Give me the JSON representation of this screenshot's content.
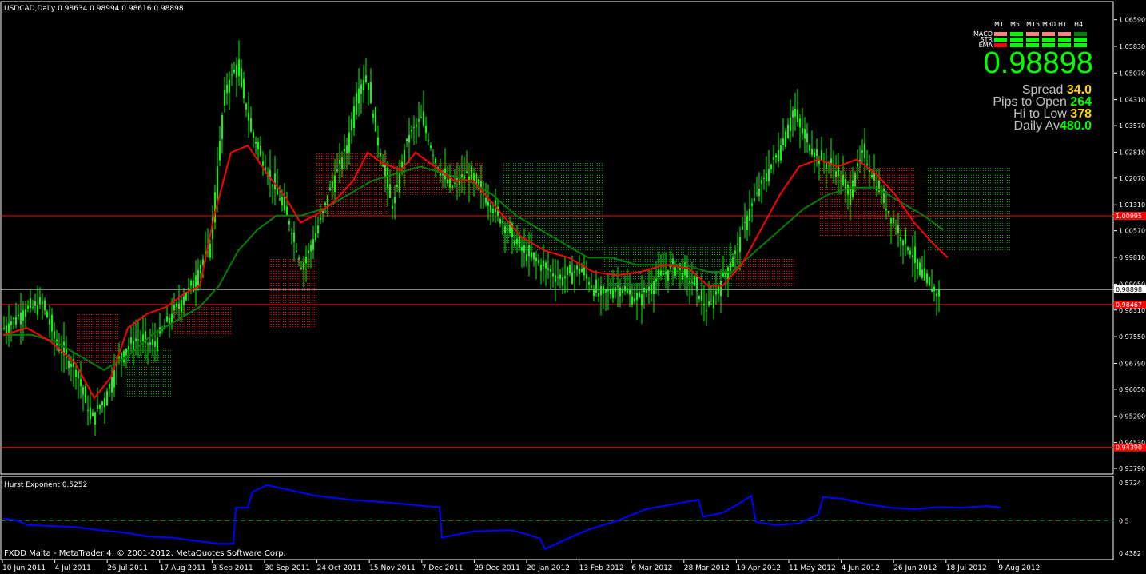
{
  "window": {
    "symbol_header": "USDCAD,Daily  0.98634 0.98994 0.98616 0.98898",
    "footer": "FXDD Malta - MetaTrader 4, © 2001-2012, MetaQuotes Software Corp."
  },
  "hud": {
    "timeframes": [
      "M1",
      "M5",
      "M15",
      "M30",
      "H1",
      "H4"
    ],
    "rows": [
      {
        "name": "MACD",
        "colors": [
          "#ff8080",
          "#00ff00",
          "#ff8080",
          "#ff8080",
          "#ff8080",
          "#008000"
        ]
      },
      {
        "name": "STR",
        "colors": [
          "#00ff00",
          "#00ff00",
          "#00ff00",
          "#00ff00",
          "#00ff00",
          "#00ff00"
        ]
      },
      {
        "name": "EMA",
        "colors": [
          "#ff0000",
          "#00ff00",
          "#00ff00",
          "#00ff00",
          "#00ff00",
          "#00ff00"
        ]
      }
    ],
    "price": "0.98898",
    "spread_label": "Spread",
    "spread_value": "34.0",
    "pips_label": "Pips to Open",
    "pips_value": "264",
    "hilo_label": "Hi to Low",
    "hilo_value": "378",
    "daily_label": "Daily Av",
    "daily_value": "480.0"
  },
  "colors": {
    "candle": "#00ff00",
    "ema_fast": "#ff0000",
    "ema_slow": "#008000",
    "cloud_bull": "#008000",
    "cloud_bear": "#ff0000",
    "hurst": "#0000ff",
    "level_line": "#ff0000"
  },
  "chart_data": [
    {
      "type": "candlestick",
      "title": "USDCAD,Daily",
      "ylim": [
        0.937,
        1.0665
      ],
      "y_ticks": [
        "1.06590",
        "1.05830",
        "1.05070",
        "1.04310",
        "1.03570",
        "1.02810",
        "1.02070",
        "1.01310",
        "1.00570",
        "0.99810",
        "0.99050",
        "0.98310",
        "0.97550",
        "0.96790",
        "0.96050",
        "0.95290",
        "0.94530",
        "0.93790"
      ],
      "x_labels": [
        "10 Jun 2011",
        "4 Jul 2011",
        "26 Jul 2011",
        "17 Aug 2011",
        "8 Sep 2011",
        "30 Sep 2011",
        "24 Oct 2011",
        "15 Nov 2011",
        "7 Dec 2011",
        "29 Dec 2011",
        "20 Jan 2012",
        "13 Feb 2012",
        "6 Mar 2012",
        "28 Mar 2012",
        "19 Apr 2012",
        "11 May 2012",
        "4 Jun 2012",
        "26 Jun 2012",
        "18 Jul 2012",
        "9 Aug 2012"
      ],
      "horizontal_levels": [
        {
          "value": 1.00995,
          "label": "1.00995",
          "color": "#ff0000"
        },
        {
          "value": 0.98898,
          "label": "0.98898",
          "color": "#ffffff"
        },
        {
          "value": 0.98467,
          "label": "0.98467",
          "color": "#ff0000"
        },
        {
          "value": 0.9439,
          "label": "0.94390",
          "color": "#ff0000"
        }
      ],
      "close_path": [
        [
          0,
          0.978
        ],
        [
          8,
          0.983
        ],
        [
          16,
          0.985
        ],
        [
          22,
          0.973
        ],
        [
          30,
          0.966
        ],
        [
          36,
          0.952
        ],
        [
          42,
          0.958
        ],
        [
          48,
          0.97
        ],
        [
          55,
          0.975
        ],
        [
          62,
          0.973
        ],
        [
          70,
          0.982
        ],
        [
          78,
          0.99
        ],
        [
          86,
          1.002
        ],
        [
          92,
          1.046
        ],
        [
          97,
          1.053
        ],
        [
          103,
          1.034
        ],
        [
          110,
          1.022
        ],
        [
          118,
          1.01
        ],
        [
          124,
          0.995
        ],
        [
          130,
          1.005
        ],
        [
          136,
          1.018
        ],
        [
          143,
          1.03
        ],
        [
          147,
          1.045
        ],
        [
          151,
          1.05
        ],
        [
          156,
          1.03
        ],
        [
          162,
          1.012
        ],
        [
          168,
          1.032
        ],
        [
          174,
          1.038
        ],
        [
          180,
          1.025
        ],
        [
          186,
          1.018
        ],
        [
          193,
          1.022
        ],
        [
          200,
          1.016
        ],
        [
          208,
          1.008
        ],
        [
          216,
          1.0
        ],
        [
          224,
          0.996
        ],
        [
          232,
          0.992
        ],
        [
          240,
          0.995
        ],
        [
          248,
          0.987
        ],
        [
          256,
          0.99
        ],
        [
          264,
          0.986
        ],
        [
          272,
          0.992
        ],
        [
          280,
          0.996
        ],
        [
          288,
          0.99
        ],
        [
          293,
          0.983
        ],
        [
          298,
          0.99
        ],
        [
          304,
          0.998
        ],
        [
          311,
          1.012
        ],
        [
          318,
          1.022
        ],
        [
          324,
          1.03
        ],
        [
          329,
          1.04
        ],
        [
          334,
          1.032
        ],
        [
          340,
          1.026
        ],
        [
          346,
          1.024
        ],
        [
          352,
          1.016
        ],
        [
          358,
          1.028
        ],
        [
          363,
          1.02
        ],
        [
          368,
          1.012
        ],
        [
          373,
          1.005
        ],
        [
          378,
          1.0
        ],
        [
          382,
          0.993
        ],
        [
          386,
          0.99
        ],
        [
          390,
          0.987
        ]
      ],
      "ema_fast": [
        [
          0,
          0.976
        ],
        [
          10,
          0.978
        ],
        [
          20,
          0.974
        ],
        [
          30,
          0.968
        ],
        [
          38,
          0.958
        ],
        [
          45,
          0.964
        ],
        [
          52,
          0.978
        ],
        [
          60,
          0.982
        ],
        [
          68,
          0.984
        ],
        [
          76,
          0.988
        ],
        [
          82,
          0.99
        ],
        [
          88,
          1.01
        ],
        [
          95,
          1.028
        ],
        [
          102,
          1.03
        ],
        [
          110,
          1.022
        ],
        [
          118,
          1.015
        ],
        [
          124,
          1.008
        ],
        [
          130,
          1.01
        ],
        [
          138,
          1.014
        ],
        [
          146,
          1.02
        ],
        [
          152,
          1.028
        ],
        [
          158,
          1.025
        ],
        [
          166,
          1.023
        ],
        [
          172,
          1.028
        ],
        [
          180,
          1.024
        ],
        [
          188,
          1.02
        ],
        [
          196,
          1.02
        ],
        [
          206,
          1.012
        ],
        [
          216,
          1.004
        ],
        [
          226,
          1.0
        ],
        [
          236,
          0.998
        ],
        [
          246,
          0.994
        ],
        [
          256,
          0.993
        ],
        [
          266,
          0.994
        ],
        [
          276,
          0.996
        ],
        [
          286,
          0.995
        ],
        [
          294,
          0.99
        ],
        [
          300,
          0.99
        ],
        [
          308,
          0.996
        ],
        [
          316,
          1.006
        ],
        [
          324,
          1.016
        ],
        [
          332,
          1.024
        ],
        [
          340,
          1.026
        ],
        [
          348,
          1.024
        ],
        [
          356,
          1.026
        ],
        [
          364,
          1.022
        ],
        [
          372,
          1.016
        ],
        [
          380,
          1.008
        ],
        [
          388,
          1.002
        ],
        [
          394,
          0.998
        ]
      ],
      "ema_slow": [
        [
          0,
          0.976
        ],
        [
          12,
          0.976
        ],
        [
          22,
          0.974
        ],
        [
          32,
          0.97
        ],
        [
          42,
          0.966
        ],
        [
          52,
          0.97
        ],
        [
          62,
          0.976
        ],
        [
          72,
          0.98
        ],
        [
          82,
          0.984
        ],
        [
          90,
          0.99
        ],
        [
          98,
          1.0
        ],
        [
          106,
          1.006
        ],
        [
          114,
          1.01
        ],
        [
          124,
          1.01
        ],
        [
          134,
          1.012
        ],
        [
          144,
          1.016
        ],
        [
          154,
          1.02
        ],
        [
          164,
          1.022
        ],
        [
          174,
          1.024
        ],
        [
          184,
          1.022
        ],
        [
          194,
          1.02
        ],
        [
          204,
          1.016
        ],
        [
          214,
          1.01
        ],
        [
          224,
          1.006
        ],
        [
          234,
          1.002
        ],
        [
          244,
          0.998
        ],
        [
          254,
          0.998
        ],
        [
          264,
          0.996
        ],
        [
          274,
          0.996
        ],
        [
          284,
          0.996
        ],
        [
          294,
          0.994
        ],
        [
          304,
          0.994
        ],
        [
          314,
          1.0
        ],
        [
          324,
          1.006
        ],
        [
          334,
          1.012
        ],
        [
          344,
          1.016
        ],
        [
          354,
          1.018
        ],
        [
          364,
          1.018
        ],
        [
          374,
          1.014
        ],
        [
          384,
          1.01
        ],
        [
          392,
          1.006
        ]
      ],
      "cloud": [
        {
          "from": 30,
          "to": 48,
          "top": 0.982,
          "bottom": 0.968,
          "bull": false
        },
        {
          "from": 50,
          "to": 70,
          "top": 0.972,
          "bottom": 0.958,
          "bull": true
        },
        {
          "from": 70,
          "to": 95,
          "top": 0.984,
          "bottom": 0.976,
          "bull": false
        },
        {
          "from": 110,
          "to": 130,
          "top": 0.998,
          "bottom": 0.978,
          "bull": false
        },
        {
          "from": 130,
          "to": 160,
          "top": 1.028,
          "bottom": 1.01,
          "bull": false
        },
        {
          "from": 160,
          "to": 200,
          "top": 1.026,
          "bottom": 1.016,
          "bull": false
        },
        {
          "from": 208,
          "to": 250,
          "top": 1.025,
          "bottom": 1.0,
          "bull": true
        },
        {
          "from": 250,
          "to": 305,
          "top": 1.002,
          "bottom": 0.99,
          "bull": true
        },
        {
          "from": 305,
          "to": 330,
          "top": 0.998,
          "bottom": 0.99,
          "bull": false
        },
        {
          "from": 340,
          "to": 380,
          "top": 1.024,
          "bottom": 1.004,
          "bull": false
        },
        {
          "from": 385,
          "to": 420,
          "top": 1.024,
          "bottom": 1.0,
          "bull": true
        }
      ]
    },
    {
      "type": "line",
      "title": "Hurst Exponent 0.5252",
      "ylim": [
        0.4382,
        0.5724
      ],
      "y_ticks": [
        "0.5724",
        "0.5",
        "0.4382"
      ],
      "dashed_level": 0.5,
      "values": [
        [
          0,
          0.505
        ],
        [
          6,
          0.5
        ],
        [
          10,
          0.492
        ],
        [
          20,
          0.49
        ],
        [
          30,
          0.488
        ],
        [
          40,
          0.482
        ],
        [
          50,
          0.478
        ],
        [
          60,
          0.47
        ],
        [
          70,
          0.468
        ],
        [
          80,
          0.462
        ],
        [
          90,
          0.456
        ],
        [
          96,
          0.456
        ],
        [
          97,
          0.525
        ],
        [
          102,
          0.525
        ],
        [
          104,
          0.555
        ],
        [
          110,
          0.568
        ],
        [
          118,
          0.56
        ],
        [
          130,
          0.548
        ],
        [
          145,
          0.54
        ],
        [
          160,
          0.535
        ],
        [
          176,
          0.528
        ],
        [
          182,
          0.526
        ],
        [
          183,
          0.468
        ],
        [
          196,
          0.48
        ],
        [
          212,
          0.482
        ],
        [
          218,
          0.475
        ],
        [
          224,
          0.466
        ],
        [
          226,
          0.446
        ],
        [
          234,
          0.463
        ],
        [
          244,
          0.483
        ],
        [
          256,
          0.5
        ],
        [
          268,
          0.522
        ],
        [
          280,
          0.532
        ],
        [
          290,
          0.54
        ],
        [
          292,
          0.508
        ],
        [
          300,
          0.515
        ],
        [
          306,
          0.53
        ],
        [
          312,
          0.548
        ],
        [
          314,
          0.498
        ],
        [
          322,
          0.492
        ],
        [
          332,
          0.495
        ],
        [
          340,
          0.512
        ],
        [
          342,
          0.545
        ],
        [
          350,
          0.542
        ],
        [
          360,
          0.532
        ],
        [
          370,
          0.525
        ],
        [
          380,
          0.522
        ],
        [
          390,
          0.526
        ],
        [
          400,
          0.525
        ],
        [
          410,
          0.528
        ],
        [
          416,
          0.5252
        ]
      ]
    }
  ]
}
